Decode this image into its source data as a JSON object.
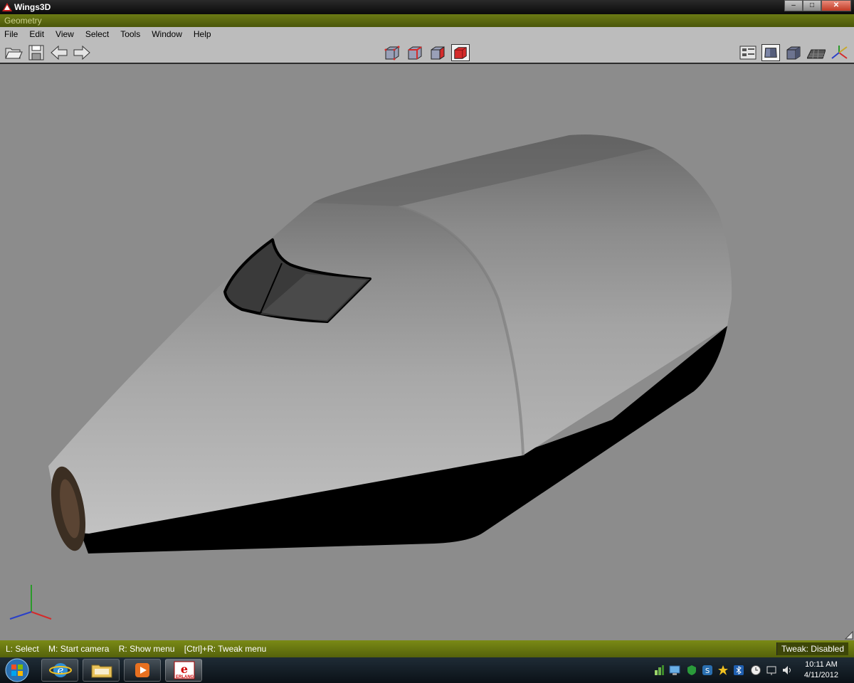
{
  "window": {
    "title": "Wings3D",
    "buttons": {
      "minimize": "–",
      "maximize": "□",
      "close": "✕"
    }
  },
  "geometry_bar": {
    "label": "Geometry"
  },
  "menu": [
    "File",
    "Edit",
    "View",
    "Select",
    "Tools",
    "Window",
    "Help"
  ],
  "toolbar": {
    "file_icons": [
      "open-folder-icon",
      "save-icon",
      "undo-arrow-icon",
      "redo-arrow-icon"
    ],
    "selection_modes": [
      "vertex-mode-icon",
      "edge-mode-icon",
      "face-mode-icon",
      "body-mode-icon"
    ],
    "active_mode": "body-mode-icon",
    "view_icons": [
      "outliner-icon",
      "smooth-shaded-icon",
      "flat-shaded-icon",
      "ground-grid-icon",
      "axes-icon"
    ]
  },
  "status": {
    "hints": [
      "L: Select",
      "M: Start camera",
      "R: Show menu",
      "[Ctrl]+R: Tweak menu"
    ],
    "tweak": "Tweak: Disabled"
  },
  "taskbar": {
    "apps": [
      "start-orb-icon",
      "internet-explorer-icon",
      "file-explorer-icon",
      "media-player-icon",
      "erlang-icon"
    ],
    "erlang_label": "ERLANG",
    "time": "10:11 AM",
    "date": "4/11/2012"
  },
  "colors": {
    "viewport": "#8c8c8c",
    "status_bar": "#6b7a14",
    "active_mode": "#d42b2b"
  }
}
